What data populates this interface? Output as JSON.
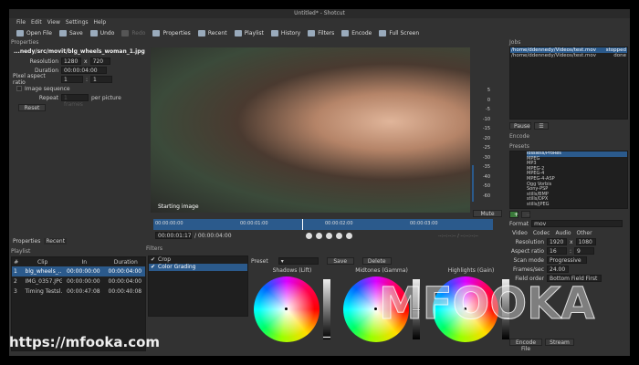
{
  "window": {
    "title": "Untitled* - Shotcut"
  },
  "menu": [
    "File",
    "Edit",
    "View",
    "Settings",
    "Help"
  ],
  "toolbar": [
    {
      "label": "Open File",
      "icon": "folder-icon",
      "enabled": true
    },
    {
      "label": "Save",
      "icon": "save-icon",
      "enabled": true
    },
    {
      "label": "Undo",
      "icon": "undo-icon",
      "enabled": true
    },
    {
      "label": "Redo",
      "icon": "redo-icon",
      "enabled": false
    },
    {
      "label": "Properties",
      "icon": "properties-icon",
      "enabled": true
    },
    {
      "label": "Recent",
      "icon": "recent-icon",
      "enabled": true
    },
    {
      "label": "Playlist",
      "icon": "playlist-icon",
      "enabled": true
    },
    {
      "label": "History",
      "icon": "history-icon",
      "enabled": true
    },
    {
      "label": "Filters",
      "icon": "filters-icon",
      "enabled": true
    },
    {
      "label": "Encode",
      "icon": "encode-icon",
      "enabled": true
    },
    {
      "label": "Full Screen",
      "icon": "fullscreen-icon",
      "enabled": true
    }
  ],
  "properties": {
    "title": "Properties",
    "filename": "...nedy/src/movit/blg_wheels_woman_1.jpg",
    "resolution_label": "Resolution",
    "res_w": "1280",
    "res_x": "x",
    "res_h": "720",
    "duration_label": "Duration",
    "duration": "00:00:04:00",
    "par_label": "Pixel aspect ratio",
    "par_num": "1",
    "par_sep": ":",
    "par_den": "1",
    "image_sequence_label": "Image sequence",
    "repeat_label": "Repeat",
    "repeat_value": "1 frames",
    "per_picture": "per picture",
    "reset": "Reset"
  },
  "left_tabs": [
    "Properties",
    "Recent"
  ],
  "playlist": {
    "title": "Playlist",
    "columns": [
      "#",
      "Clip",
      "In",
      "Duration"
    ],
    "rows": [
      [
        "1",
        "blg_wheels_...",
        "00:00:00:00",
        "00:00:04:00"
      ],
      [
        "2",
        "IMG_0357.JPG",
        "00:00:00:00",
        "00:00:04:00"
      ],
      [
        "3",
        "Timing Testsl...",
        "00:00:47:08",
        "00:00:40:08"
      ]
    ]
  },
  "viewer": {
    "caption": "Starting image",
    "meter_scale": [
      "5",
      "0",
      "-5",
      "-10",
      "-15",
      "-20",
      "-25",
      "-30",
      "-35",
      "-40",
      "-50",
      "-60"
    ],
    "mute": "Mute",
    "ruler": [
      "00:00:00:00",
      "00:00:01:00",
      "00:00:02:00",
      "00:00:03:00"
    ],
    "position": "00:00:01:17",
    "total": "/ 00:00:04:00",
    "inout": "--:--:--:-- / --:--:--:--"
  },
  "filters": {
    "title": "Filters",
    "items": [
      {
        "label": "Crop",
        "checked": true
      },
      {
        "label": "Color Grading",
        "checked": true,
        "selected": true
      }
    ],
    "preset_label": "Preset",
    "save": "Save",
    "delete": "Delete",
    "wheels": [
      {
        "label": "Shadows (Lift)",
        "level": 0.02
      },
      {
        "label": "Midtones (Gamma)",
        "level": 0.5
      },
      {
        "label": "Highlights (Gain)",
        "level": 0.35
      }
    ]
  },
  "jobs": {
    "title": "Jobs",
    "rows": [
      [
        "/home/ddennedy/Videos/test.mov",
        "stopped"
      ],
      [
        "/home/ddennedy/Videos/test.mov",
        "done"
      ]
    ],
    "pause": "Pause"
  },
  "encode": {
    "title": "Encode",
    "presets_label": "Presets",
    "presets": [
      "lossless/ProRes",
      "MPEG",
      "MP3",
      "MPEG-2",
      "MPEG-4",
      "MPEG-4-ASP",
      "Ogg Vorbis",
      "Sony-PSP",
      "stills/BMP",
      "stills/DPX",
      "stills/JPEG"
    ],
    "format_label": "Format",
    "format": "mov",
    "tabs": [
      "Video",
      "Codec",
      "Audio",
      "Other"
    ],
    "resolution_label": "Resolution",
    "res_w": "1920",
    "res_x": "x",
    "res_h": "1080",
    "aspect_label": "Aspect ratio",
    "aspect_w": "16",
    "aspect_sep": ":",
    "aspect_h": "9",
    "scan_label": "Scan mode",
    "scan": "Progressive",
    "fps_label": "Frames/sec",
    "fps": "24.00",
    "field_label": "Field order",
    "field": "Bottom Field First",
    "encode_file": "Encode File",
    "stream": "Stream"
  },
  "watermark": {
    "url": "https://mfooka.com",
    "logo": "MFOOKA"
  },
  "colors": {
    "accent": "#2b5a8c",
    "panel": "#323232"
  }
}
